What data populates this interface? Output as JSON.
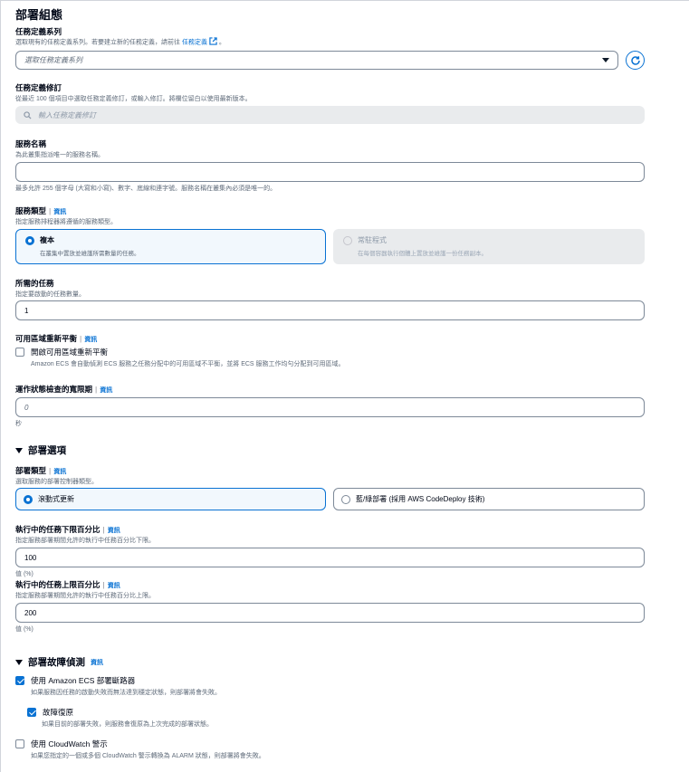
{
  "page_title": "部署組態",
  "task_def_family": {
    "label": "任務定義系列",
    "desc": "選取現有的任務定義系列。若要建立新的任務定義，請前往",
    "link": "任務定義",
    "desc_end": "。",
    "placeholder": "選取任務定義系列"
  },
  "task_def_revision": {
    "label": "任務定義修訂",
    "desc": "從最近 100 個項目中選取任務定義修訂，或輸入修訂。將欄位留白以使用最新版本。",
    "placeholder": "輸入任務定義修訂"
  },
  "service_name": {
    "label": "服務名稱",
    "desc": "為此叢集指派唯一的服務名稱。",
    "value": "",
    "hint": "最多允許 255 個字母 (大寫和小寫)、數字、底線和連字號。服務名稱在叢集內必須是唯一的。"
  },
  "service_type": {
    "label": "服務類型",
    "info": "資訊",
    "desc": "指定服務排程器將遵循的服務類型。",
    "options": [
      {
        "title": "複本",
        "desc": "在叢集中置放並維護所需數量的任務。"
      },
      {
        "title": "常駐程式",
        "desc": "在每個容器執行個體上置放並維護一份任務副本。"
      }
    ]
  },
  "desired_tasks": {
    "label": "所需的任務",
    "desc": "指定要啟動的任務數量。",
    "value": "1"
  },
  "az_rebalancing": {
    "label": "可用區域重新平衡",
    "info": "資訊",
    "checkbox_label": "開啟可用區域重新平衡",
    "checkbox_desc": "Amazon ECS 會自動偵測 ECS 服務之任務分配中的可用區域不平衡，並將 ECS 服務工作均勻分配到可用區域。"
  },
  "health_check_grace": {
    "label": "運作狀態檢查的寬限期",
    "info": "資訊",
    "placeholder": "0",
    "unit": "秒"
  },
  "deployment_options": {
    "heading": "部署選項",
    "type_label": "部署類型",
    "info": "資訊",
    "type_desc": "選取服務的部署控制器類型。",
    "options": [
      {
        "title": "滾動式更新"
      },
      {
        "title": "藍/綠部署 (採用 AWS CodeDeploy 技術)"
      }
    ],
    "min_label": "執行中的任務下限百分比",
    "min_desc": "指定服務部署期間允許的執行中任務百分比下限。",
    "min_value": "100",
    "min_unit": "值 (%)",
    "max_label": "執行中的任務上限百分比",
    "max_desc": "指定服務部署期間允許的執行中任務百分比上限。",
    "max_value": "200",
    "max_unit": "值 (%)"
  },
  "failure_detection": {
    "heading": "部署故障偵測",
    "info": "資訊",
    "circuit_breaker_label": "使用 Amazon ECS 部署斷路器",
    "circuit_breaker_desc": "如果服務因任務的啟動失敗而無法達到穩定狀態，則部署將會失敗。",
    "rollback_label": "故障復原",
    "rollback_desc": "如果目前的部署失敗，則服務會復原為上次完成的部署狀態。",
    "cloudwatch_label": "使用 CloudWatch 警示",
    "cloudwatch_desc": "如果您指定的一個或多個 CloudWatch 警示轉換為 ALARM 狀態，則部署將會失敗。"
  },
  "icons": {
    "external_link": "external-link-icon",
    "refresh": "refresh-icon",
    "search": "search-icon",
    "caret": "caret-down-icon"
  },
  "colors": {
    "accent": "#0972d3",
    "text": "#000716",
    "muted": "#5f6b7a",
    "disabled_bg": "#e9ebed"
  }
}
